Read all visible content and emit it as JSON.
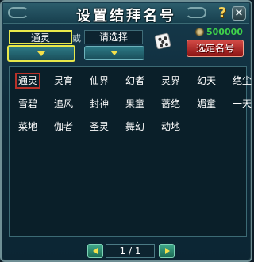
{
  "dialog": {
    "title": "设置结拜名号",
    "help_label": "?",
    "close_label": "×"
  },
  "selectors": {
    "first_name": "通灵",
    "or_text": "或",
    "second_name": "请选择"
  },
  "currency": {
    "amount": "500000",
    "icon": "coin-icon"
  },
  "confirm_label": "选定名号",
  "names": [
    "通灵",
    "灵宵",
    "仙界",
    "幻者",
    "灵界",
    "幻天",
    "绝尘",
    "雪碧",
    "追风",
    "封神",
    "果童",
    "蔷绝",
    "媚童",
    "一天",
    "菜地",
    "伽者",
    "圣灵",
    "舞幻",
    "动地"
  ],
  "selected_name": "通灵",
  "pagination": {
    "current": "1",
    "total": "1",
    "display": "1 / 1"
  },
  "colors": {
    "selection_highlight": "#e8e84a",
    "selected_cell_border": "#b8322a",
    "currency_text": "#3fd24a",
    "confirm_button": "#b8302a"
  }
}
